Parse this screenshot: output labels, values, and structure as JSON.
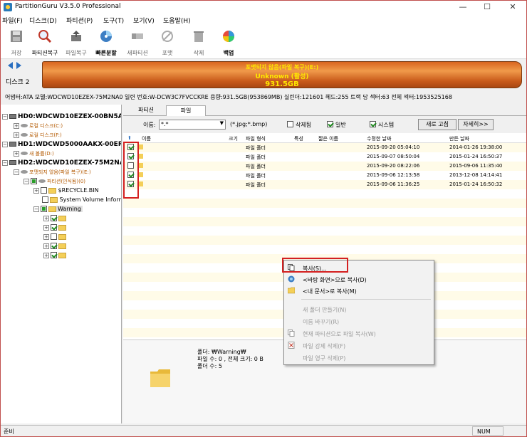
{
  "window": {
    "title": "PartitionGuru V3.5.0 Professional",
    "controls": [
      "—",
      "☐",
      "✕"
    ]
  },
  "menu": [
    "파일(F)",
    "디스크(D)",
    "파티션(P)",
    "도구(T)",
    "보기(V)",
    "도움말(H)"
  ],
  "toolbar": [
    {
      "label": "저장",
      "icon": "save-icon"
    },
    {
      "label": "파티션복구",
      "icon": "search-recover-icon"
    },
    {
      "label": "파일복구",
      "icon": "file-recover-icon"
    },
    {
      "label": "빠른분할",
      "icon": "quick-partition-icon"
    },
    {
      "label": "새파티션",
      "icon": "new-partition-icon"
    },
    {
      "label": "포맷",
      "icon": "format-icon"
    },
    {
      "label": "삭제",
      "icon": "trash-icon"
    },
    {
      "label": "백업",
      "icon": "backup-icon"
    }
  ],
  "disk_area": {
    "disk_label": "디스크  2",
    "bar_line1": "포맷되지 않음(파일 복구)(E:)",
    "bar_line2": "Unknown (활성)",
    "bar_line3": "931.5GB"
  },
  "info_line": "어댑터:ATA  모델:WDCWD10EZEX-75M2NA0  일련 번호:W-DCW3C7FVCCKRE  용량:931.5GB(953869MB)  실린더:121601  헤드:255  트랙 당 섹터:63  전체 섹터:1953525168",
  "tree": [
    {
      "text": "HD0:WDCWD10EZEX-00BN5A",
      "type": "disk",
      "indent": 0
    },
    {
      "text": "로컬 디스크(C:)",
      "type": "part",
      "indent": 1
    },
    {
      "text": "로컬 디스크(F:)",
      "type": "part",
      "indent": 1
    },
    {
      "text": "HD1:WDCWD5000AAKX-00ER",
      "type": "disk",
      "indent": 0
    },
    {
      "text": "새 볼륨(D:)",
      "type": "part",
      "indent": 1
    },
    {
      "text": "HD2:WDCWD10EZEX-75M2NA",
      "type": "disk",
      "indent": 0
    },
    {
      "text": "포맷되지 않음(파일 복구)(E:)",
      "type": "part",
      "indent": 1
    },
    {
      "text": "파티션(인식됨)(0)",
      "type": "part",
      "indent": 2
    },
    {
      "text": "$RECYCLE.BIN",
      "type": "folder",
      "indent": 3
    },
    {
      "text": "System Volume Inform",
      "type": "folder",
      "indent": 3
    },
    {
      "text": "Warning",
      "type": "folder",
      "indent": 3
    },
    {
      "text": "",
      "type": "folder",
      "indent": 4
    },
    {
      "text": "",
      "type": "folder",
      "indent": 4
    },
    {
      "text": "",
      "type": "folder",
      "indent": 4
    },
    {
      "text": "",
      "type": "folder",
      "indent": 4
    },
    {
      "text": "",
      "type": "folder",
      "indent": 4
    }
  ],
  "tabs": [
    "파티션",
    "파일"
  ],
  "filter": {
    "name_label": "이름:",
    "name_value": "*.*",
    "ext_hint": "(*.jpg;*.bmp)",
    "deleted_label": "삭제됨",
    "normal_label": "일반",
    "system_label": "시스템",
    "refresh_label": "새로 고침",
    "detail_label": "자세히>>"
  },
  "columns": [
    "이름",
    "크기",
    "파일 형식",
    "특성",
    "짧은 이름",
    "수정한 날짜",
    "만든 날짜"
  ],
  "files": [
    {
      "name": "",
      "type": "파일 폴더",
      "modified": "2015-09-20 05:04:10",
      "created": "2014-01-26 19:38:00",
      "checked": true
    },
    {
      "name": "",
      "type": "파일 폴더",
      "modified": "2015-09-07 08:50:04",
      "created": "2015-01-24 16:50:37",
      "checked": true
    },
    {
      "name": "",
      "type": "파일 폴더",
      "modified": "2015-09-20 08:22:06",
      "created": "2015-09-06 11:35:40",
      "checked": false
    },
    {
      "name": "",
      "type": "파일 폴더",
      "modified": "2015-09-06 12:13:58",
      "created": "2013-12-08 14:14:41",
      "checked": true
    },
    {
      "name": "",
      "type": "파일 폴더",
      "modified": "2015-09-06 11:36:25",
      "created": "2015-01-24 16:50:32",
      "checked": true
    }
  ],
  "detail": {
    "folder_line": "폴더: ₩Warning₩",
    "count_line": "파일 수: 0 , 전체 크기: 0 B",
    "folders_line": "폴더 수: 5"
  },
  "context_menu": [
    {
      "label": "복사(S)...",
      "enabled": true,
      "icon": "copy-icon"
    },
    {
      "label": "<바탕 화면>으로 복사(D)",
      "enabled": true,
      "icon": "desktop-icon"
    },
    {
      "label": "<내 문서>로 복사(M)",
      "enabled": true,
      "icon": "documents-icon"
    },
    {
      "label": "새 폴더 만들기(N)",
      "enabled": false,
      "icon": ""
    },
    {
      "label": "이름 바꾸기(R)",
      "enabled": false,
      "icon": ""
    },
    {
      "label": "현재 파티션으로 파일 복사(W)",
      "enabled": false,
      "icon": "copy-to-partition-icon"
    },
    {
      "label": "파일 강제 삭제(F)",
      "enabled": false,
      "icon": "force-delete-icon"
    },
    {
      "label": "파일 영구 삭제(P)",
      "enabled": false,
      "icon": ""
    }
  ],
  "status": {
    "left": "준비",
    "right": "NUM"
  }
}
